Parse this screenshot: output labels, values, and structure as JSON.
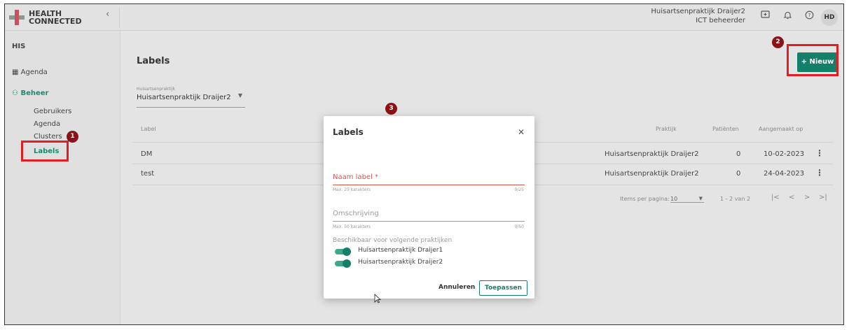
{
  "topbar": {
    "logo_line1": "HEALTH",
    "logo_line2": "CONNECTED",
    "collapse_icon": "chevron-left-icon",
    "practice": "Huisartsenpraktijk Draijer2",
    "role": "ICT beheerder",
    "icons": [
      "feedback-icon",
      "bell-icon",
      "help-icon"
    ],
    "avatar_initials": "HD"
  },
  "sidebar": {
    "section": "HIS",
    "agenda": "Agenda",
    "beheer": "Beheer",
    "items": [
      "Gebruikers",
      "Agenda",
      "Clusters",
      "Labels"
    ],
    "active": "Labels"
  },
  "main": {
    "title": "Labels",
    "practice_field_label": "Huisartsenpraktijk",
    "practice_value": "Huisartsenpraktijk Draijer2",
    "new_button": "+ Nieuw",
    "columns": {
      "label": "Label",
      "praktijk": "Praktijk",
      "patienten": "Patiënten",
      "aangemaakt": "Aangemaakt op"
    },
    "rows": [
      {
        "label": "DM",
        "praktijk": "Huisartsenpraktijk Draijer2",
        "patienten": "0",
        "aangemaakt": "10-02-2023"
      },
      {
        "label": "test",
        "praktijk": "Huisartsenpraktijk Draijer2",
        "patienten": "0",
        "aangemaakt": "24-04-2023"
      }
    ],
    "pagination": {
      "items_per_page_label": "Items per pagina:",
      "items_per_page_value": "10",
      "range": "1 - 2 van 2",
      "first": "|<",
      "prev": "<",
      "next": ">",
      "last": ">|"
    }
  },
  "modal": {
    "title": "Labels",
    "name_label": "Naam label *",
    "name_hint": "Max. 25 karakters",
    "name_count": "0/25",
    "desc_placeholder": "Omschrijving",
    "desc_hint": "Max. 50 karakters",
    "desc_count": "0/50",
    "available_label": "Beschikbaar voor volgende praktijken",
    "practices": [
      "Huisartsenpraktijk Draijer1",
      "Huisartsenpraktijk Draijer2"
    ],
    "cancel": "Annuleren",
    "apply": "Toepassen"
  },
  "annotations": {
    "badge1": "1",
    "badge2": "2",
    "badge3": "3"
  },
  "colors": {
    "accent": "#15806a",
    "highlight": "#e21d24",
    "badge": "#8b1216",
    "error": "#d9534f"
  }
}
